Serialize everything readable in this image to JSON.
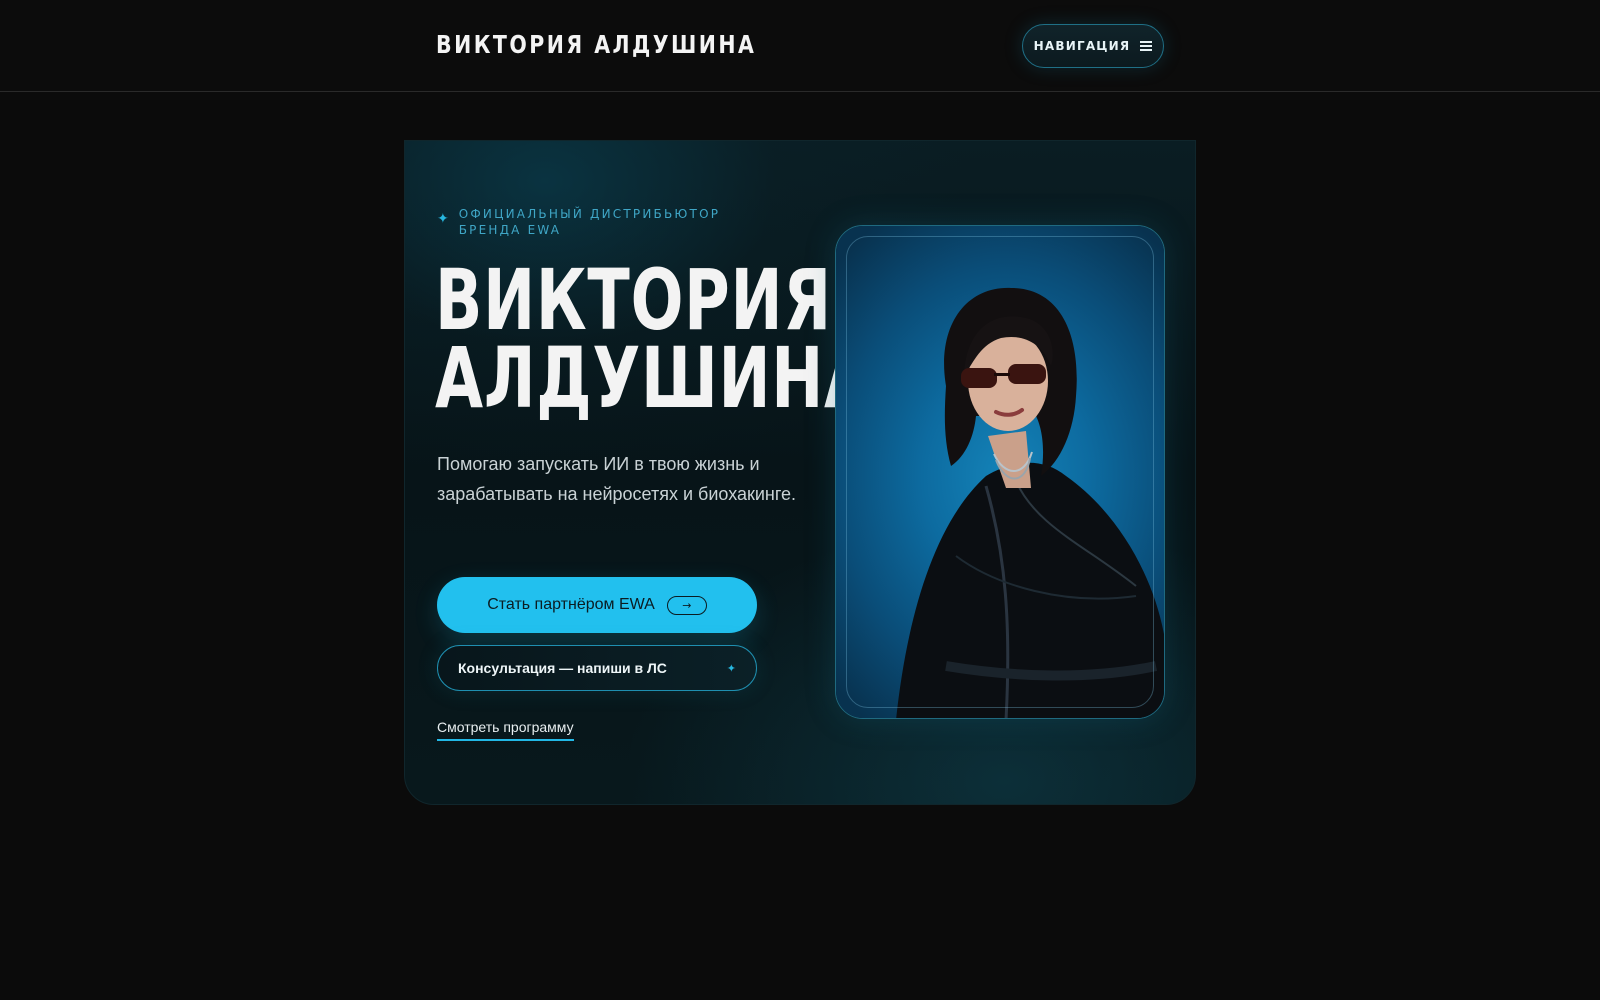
{
  "header": {
    "brand": "ВИКТОРИЯ АЛДУШИНА",
    "nav_label": "НАВИГАЦИЯ",
    "nav_icon": "hamburger-icon"
  },
  "hero": {
    "eyebrow": "ОФИЦИАЛЬНЫЙ ДИСТРИБЬЮТОР БРЕНДА EWA",
    "eyebrow_icon": "sparkle-icon",
    "title_line1": "ВИКТОРИЯ",
    "title_line2": "АЛДУШИНА",
    "subtitle": "Помогаю запускать ИИ в твою жизнь и зарабатывать на нейросетях и биохакинге.",
    "primary_cta": "Стать партнёром EWA",
    "primary_cta_icon": "arrow-right-icon",
    "secondary_cta": "Консультация — напиши в ЛС",
    "secondary_cta_icon": "sparkle-icon",
    "program_link": "Смотреть программу",
    "portrait_alt": "portrait"
  },
  "colors": {
    "background": "#0b0b0b",
    "accent": "#22c0ee",
    "card": "#071418",
    "eyebrow": "#3fa6c6"
  }
}
